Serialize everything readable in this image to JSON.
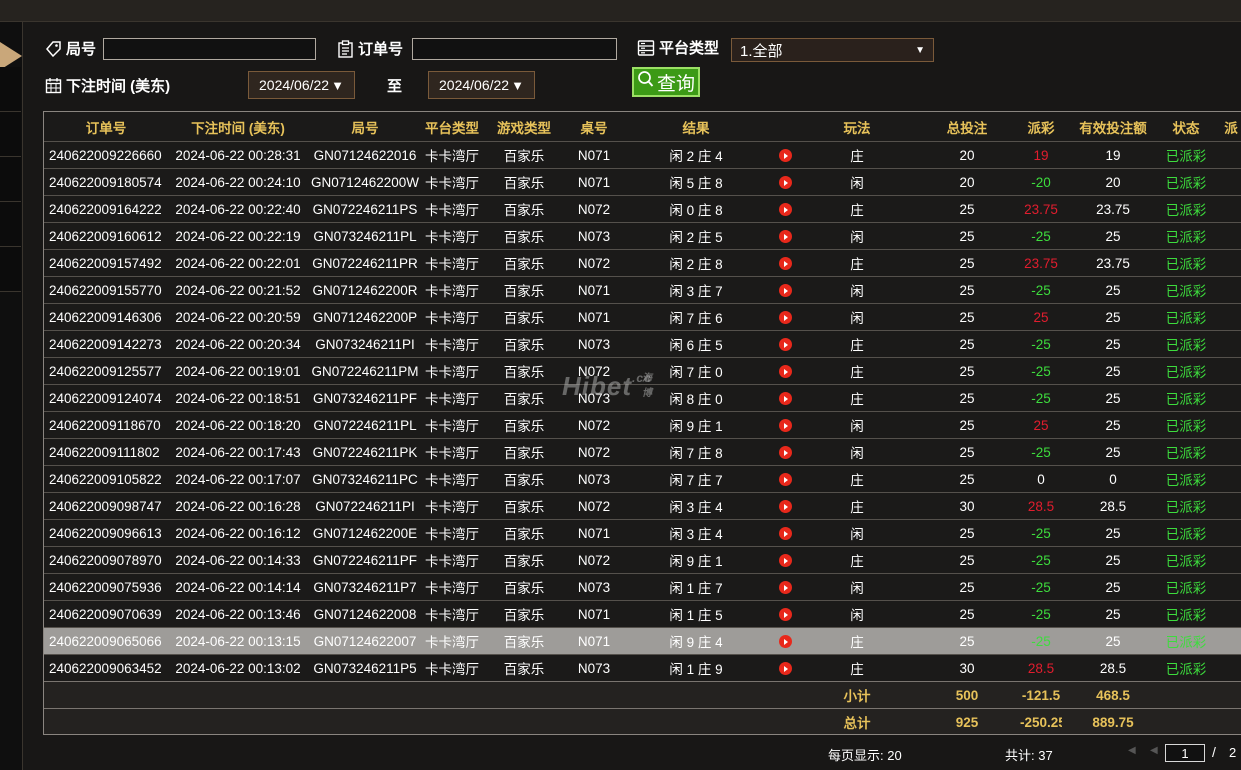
{
  "filters": {
    "round_label": "局号",
    "round_value": "",
    "order_label": "订单号",
    "order_value": "",
    "platform_label": "平台类型",
    "platform_value": "1.全部",
    "bet_time_label": "下注时间 (美东)",
    "date_from": "2024/06/22",
    "to_label": "至",
    "date_to": "2024/06/22",
    "query_label": "查询"
  },
  "table": {
    "headers": [
      "订单号",
      "下注时间 (美东)",
      "局号",
      "平台类型",
      "游戏类型",
      "桌号",
      "结果",
      "",
      "玩法",
      "总投注",
      "派彩",
      "有效投注额",
      "状态",
      "派"
    ],
    "rows": [
      {
        "order": "240622009226660",
        "time": "2024-06-22 00:28:31",
        "round": "GN07124622016",
        "platform": "卡卡湾厅",
        "game": "百家乐",
        "table": "N071",
        "result": "闲 2 庄 4",
        "play": "庄",
        "bet": "20",
        "payout": "19",
        "payout_type": "pos",
        "valid": "19",
        "status": "已派彩"
      },
      {
        "order": "240622009180574",
        "time": "2024-06-22 00:24:10",
        "round": "GN0712462200W",
        "platform": "卡卡湾厅",
        "game": "百家乐",
        "table": "N071",
        "result": "闲 5 庄 8",
        "play": "闲",
        "bet": "20",
        "payout": "-20",
        "payout_type": "neg",
        "valid": "20",
        "status": "已派彩"
      },
      {
        "order": "240622009164222",
        "time": "2024-06-22 00:22:40",
        "round": "GN072246211PS",
        "platform": "卡卡湾厅",
        "game": "百家乐",
        "table": "N072",
        "result": "闲 0 庄 8",
        "play": "庄",
        "bet": "25",
        "payout": "23.75",
        "payout_type": "pos",
        "valid": "23.75",
        "status": "已派彩"
      },
      {
        "order": "240622009160612",
        "time": "2024-06-22 00:22:19",
        "round": "GN073246211PL",
        "platform": "卡卡湾厅",
        "game": "百家乐",
        "table": "N073",
        "result": "闲 2 庄 5",
        "play": "闲",
        "bet": "25",
        "payout": "-25",
        "payout_type": "neg",
        "valid": "25",
        "status": "已派彩"
      },
      {
        "order": "240622009157492",
        "time": "2024-06-22 00:22:01",
        "round": "GN072246211PR",
        "platform": "卡卡湾厅",
        "game": "百家乐",
        "table": "N072",
        "result": "闲 2 庄 8",
        "play": "庄",
        "bet": "25",
        "payout": "23.75",
        "payout_type": "pos",
        "valid": "23.75",
        "status": "已派彩"
      },
      {
        "order": "240622009155770",
        "time": "2024-06-22 00:21:52",
        "round": "GN0712462200R",
        "platform": "卡卡湾厅",
        "game": "百家乐",
        "table": "N071",
        "result": "闲 3 庄 7",
        "play": "闲",
        "bet": "25",
        "payout": "-25",
        "payout_type": "neg",
        "valid": "25",
        "status": "已派彩"
      },
      {
        "order": "240622009146306",
        "time": "2024-06-22 00:20:59",
        "round": "GN0712462200P",
        "platform": "卡卡湾厅",
        "game": "百家乐",
        "table": "N071",
        "result": "闲 7 庄 6",
        "play": "闲",
        "bet": "25",
        "payout": "25",
        "payout_type": "pos",
        "valid": "25",
        "status": "已派彩"
      },
      {
        "order": "240622009142273",
        "time": "2024-06-22 00:20:34",
        "round": "GN073246211PI",
        "platform": "卡卡湾厅",
        "game": "百家乐",
        "table": "N073",
        "result": "闲 6 庄 5",
        "play": "庄",
        "bet": "25",
        "payout": "-25",
        "payout_type": "neg",
        "valid": "25",
        "status": "已派彩"
      },
      {
        "order": "240622009125577",
        "time": "2024-06-22 00:19:01",
        "round": "GN072246211PM",
        "platform": "卡卡湾厅",
        "game": "百家乐",
        "table": "N072",
        "result": "闲 7 庄 0",
        "play": "庄",
        "bet": "25",
        "payout": "-25",
        "payout_type": "neg",
        "valid": "25",
        "status": "已派彩"
      },
      {
        "order": "240622009124074",
        "time": "2024-06-22 00:18:51",
        "round": "GN073246211PF",
        "platform": "卡卡湾厅",
        "game": "百家乐",
        "table": "N073",
        "result": "闲 8 庄 0",
        "play": "庄",
        "bet": "25",
        "payout": "-25",
        "payout_type": "neg",
        "valid": "25",
        "status": "已派彩"
      },
      {
        "order": "240622009118670",
        "time": "2024-06-22 00:18:20",
        "round": "GN072246211PL",
        "platform": "卡卡湾厅",
        "game": "百家乐",
        "table": "N072",
        "result": "闲 9 庄 1",
        "play": "闲",
        "bet": "25",
        "payout": "25",
        "payout_type": "pos",
        "valid": "25",
        "status": "已派彩"
      },
      {
        "order": "240622009111802",
        "time": "2024-06-22 00:17:43",
        "round": "GN072246211PK",
        "platform": "卡卡湾厅",
        "game": "百家乐",
        "table": "N072",
        "result": "闲 7 庄 8",
        "play": "闲",
        "bet": "25",
        "payout": "-25",
        "payout_type": "neg",
        "valid": "25",
        "status": "已派彩"
      },
      {
        "order": "240622009105822",
        "time": "2024-06-22 00:17:07",
        "round": "GN073246211PC",
        "platform": "卡卡湾厅",
        "game": "百家乐",
        "table": "N073",
        "result": "闲 7 庄 7",
        "play": "庄",
        "bet": "25",
        "payout": "0",
        "payout_type": "zero",
        "valid": "0",
        "status": "已派彩"
      },
      {
        "order": "240622009098747",
        "time": "2024-06-22 00:16:28",
        "round": "GN072246211PI",
        "platform": "卡卡湾厅",
        "game": "百家乐",
        "table": "N072",
        "result": "闲 3 庄 4",
        "play": "庄",
        "bet": "30",
        "payout": "28.5",
        "payout_type": "pos",
        "valid": "28.5",
        "status": "已派彩"
      },
      {
        "order": "240622009096613",
        "time": "2024-06-22 00:16:12",
        "round": "GN0712462200E",
        "platform": "卡卡湾厅",
        "game": "百家乐",
        "table": "N071",
        "result": "闲 3 庄 4",
        "play": "闲",
        "bet": "25",
        "payout": "-25",
        "payout_type": "neg",
        "valid": "25",
        "status": "已派彩"
      },
      {
        "order": "240622009078970",
        "time": "2024-06-22 00:14:33",
        "round": "GN072246211PF",
        "platform": "卡卡湾厅",
        "game": "百家乐",
        "table": "N072",
        "result": "闲 9 庄 1",
        "play": "庄",
        "bet": "25",
        "payout": "-25",
        "payout_type": "neg",
        "valid": "25",
        "status": "已派彩"
      },
      {
        "order": "240622009075936",
        "time": "2024-06-22 00:14:14",
        "round": "GN073246211P7",
        "platform": "卡卡湾厅",
        "game": "百家乐",
        "table": "N073",
        "result": "闲 1 庄 7",
        "play": "闲",
        "bet": "25",
        "payout": "-25",
        "payout_type": "neg",
        "valid": "25",
        "status": "已派彩"
      },
      {
        "order": "240622009070639",
        "time": "2024-06-22 00:13:46",
        "round": "GN07124622008",
        "platform": "卡卡湾厅",
        "game": "百家乐",
        "table": "N071",
        "result": "闲 1 庄 5",
        "play": "闲",
        "bet": "25",
        "payout": "-25",
        "payout_type": "neg",
        "valid": "25",
        "status": "已派彩"
      },
      {
        "order": "240622009065066",
        "time": "2024-06-22 00:13:15",
        "round": "GN07124622007",
        "platform": "卡卡湾厅",
        "game": "百家乐",
        "table": "N071",
        "result": "闲 9 庄 4",
        "play": "庄",
        "bet": "25",
        "payout": "-25",
        "payout_type": "neg",
        "valid": "25",
        "status": "已派彩"
      },
      {
        "order": "240622009063452",
        "time": "2024-06-22 00:13:02",
        "round": "GN073246211P5",
        "platform": "卡卡湾厅",
        "game": "百家乐",
        "table": "N073",
        "result": "闲 1 庄 9",
        "play": "庄",
        "bet": "30",
        "payout": "28.5",
        "payout_type": "pos",
        "valid": "28.5",
        "status": "已派彩"
      }
    ],
    "selected_row": 18,
    "subtotal": {
      "label": "小计",
      "bet": "500",
      "payout": "-121.5",
      "valid": "468.5"
    },
    "grand_total": {
      "label": "总计",
      "bet": "925",
      "payout": "-250.25",
      "valid": "889.75"
    }
  },
  "watermark": {
    "text": "Hibet",
    "suffix": ".cc",
    "cn": "海博"
  },
  "pagination": {
    "per_page": "每页显示: 20",
    "total": "共计: 37",
    "current_page": "1",
    "slash": "/",
    "total_pages": "2"
  }
}
